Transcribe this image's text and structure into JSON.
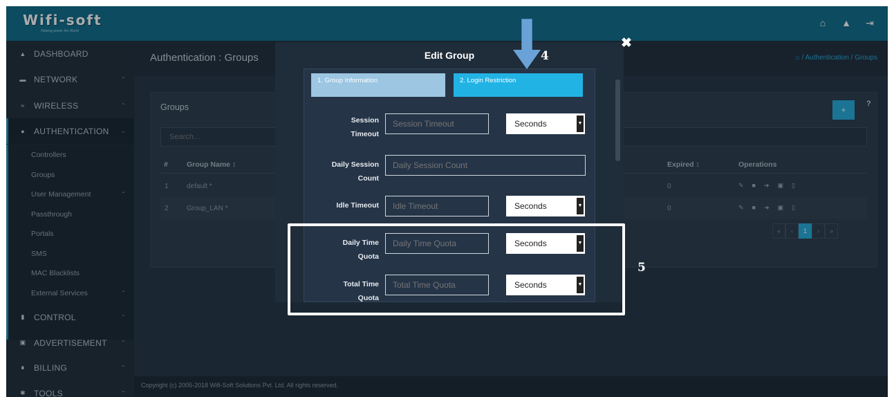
{
  "header": {
    "brand": "Wifi-soft",
    "tagline": "Helping power the World",
    "icons": [
      "home-icon",
      "bell-icon",
      "logout-icon"
    ]
  },
  "sidebar": {
    "items": [
      {
        "label": "DASHBOARD",
        "icon": "home-icon"
      },
      {
        "label": "NETWORK",
        "icon": "network-icon",
        "chevron": "^"
      },
      {
        "label": "WIRELESS",
        "icon": "wifi-icon",
        "chevron": "^"
      },
      {
        "label": "AUTHENTICATION",
        "icon": "shield-icon",
        "chevron": "v"
      },
      {
        "label": "CONTROL",
        "icon": "control-icon",
        "chevron": "^"
      },
      {
        "label": "ADVERTISEMENT",
        "icon": "ad-icon",
        "chevron": "^"
      },
      {
        "label": "BILLING",
        "icon": "billing-icon",
        "chevron": "^"
      },
      {
        "label": "TOOLS",
        "icon": "tools-icon",
        "chevron": "^"
      }
    ],
    "subitems": [
      {
        "label": "Controllers"
      },
      {
        "label": "Groups"
      },
      {
        "label": "User Management",
        "chevron": "^"
      },
      {
        "label": "Passthrough"
      },
      {
        "label": "Portals"
      },
      {
        "label": "SMS"
      },
      {
        "label": "MAC Blacklists"
      },
      {
        "label": "External Services",
        "chevron": "^"
      }
    ]
  },
  "page": {
    "title": "Authentication : Groups",
    "breadcrumb": "/ Authentication / Groups",
    "panel_title": "Groups",
    "search_placeholder": "Search...",
    "columns": {
      "num": "#",
      "name": "Group Name ↕",
      "hidden": "↕",
      "expired": "Expired ↕",
      "operations": "Operations"
    },
    "rows": [
      {
        "num": "1",
        "name": "default *",
        "expired": "0"
      },
      {
        "num": "2",
        "name": "Group_LAN *",
        "expired": "0"
      }
    ],
    "pager": [
      "«",
      "‹",
      "1",
      "›",
      "»"
    ],
    "footer": "Copyright (c) 2005-2018 Wifi-Soft Solutions Pvt. Ltd. All rights reserved."
  },
  "modal": {
    "title": "Edit Group",
    "steps": [
      "1. Group Information",
      "2. Login Restriction"
    ],
    "fields": [
      {
        "label_line1": "Session",
        "label_line2": "Timeout",
        "placeholder": "Session Timeout",
        "unit": "Seconds"
      },
      {
        "label_line1": "Daily Session",
        "label_line2": "Count",
        "placeholder": "Daily Session Count"
      },
      {
        "label_line1": "Idle Timeout",
        "label_line2": "",
        "placeholder": "Idle Timeout",
        "unit": "Seconds"
      },
      {
        "label_line1": "Daily Time",
        "label_line2": "Quota",
        "placeholder": "Daily Time Quota",
        "unit": "Seconds"
      },
      {
        "label_line1": "Total Time",
        "label_line2": "Quota",
        "placeholder": "Total Time Quota",
        "unit": "Seconds"
      }
    ]
  },
  "annotations": {
    "label4": "4",
    "label5": "5"
  }
}
